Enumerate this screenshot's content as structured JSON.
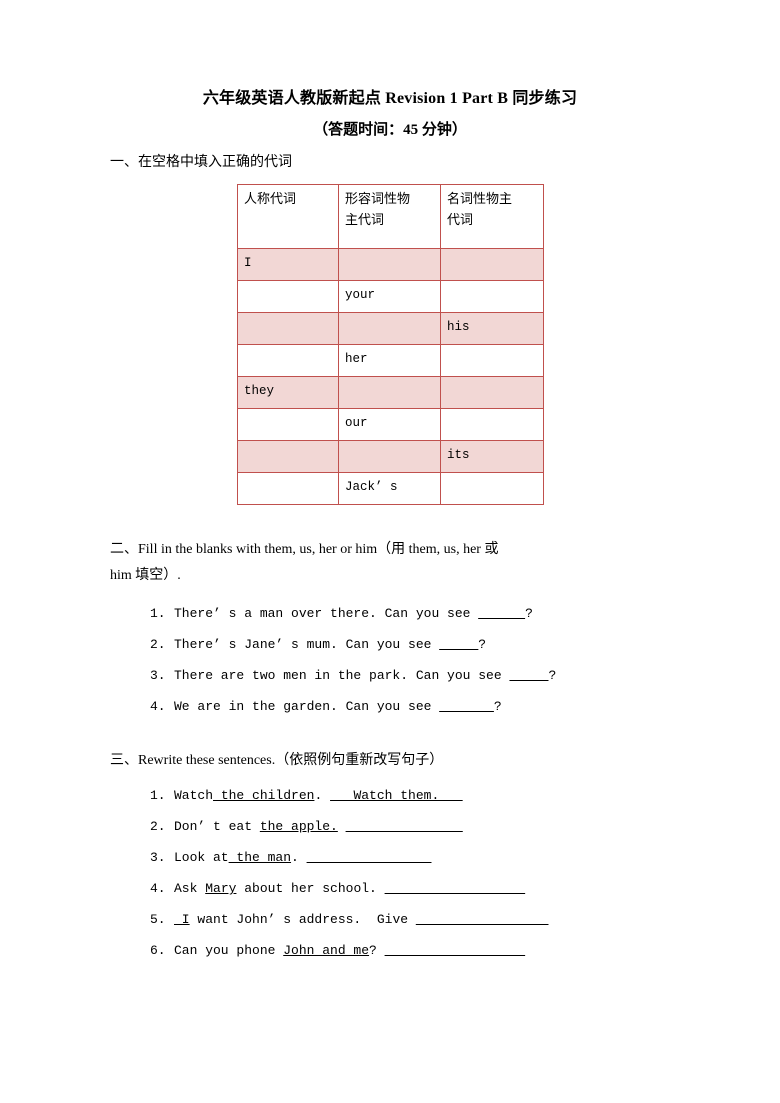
{
  "document": {
    "title": "六年级英语人教版新起点 Revision 1 Part B 同步练习",
    "subtitle": "（答题时间：45 分钟）"
  },
  "section_one": {
    "heading": "一、在空格中填入正确的代词",
    "table": {
      "headers": [
        "人称代词",
        "形容词性物主代词",
        "名词性物主代词"
      ],
      "header_cells": [
        {
          "line1": "人称代词",
          "line2": ""
        },
        {
          "line1": "形容词性物",
          "line2": "主代词"
        },
        {
          "line1": "名词性物主",
          "line2": "代词"
        }
      ],
      "rows": [
        {
          "shaded": true,
          "cells": [
            "I",
            "",
            ""
          ]
        },
        {
          "shaded": false,
          "cells": [
            "",
            "your",
            ""
          ]
        },
        {
          "shaded": true,
          "cells": [
            "",
            "",
            "his"
          ]
        },
        {
          "shaded": false,
          "cells": [
            "",
            "her",
            ""
          ]
        },
        {
          "shaded": true,
          "cells": [
            "they",
            "",
            ""
          ]
        },
        {
          "shaded": false,
          "cells": [
            "",
            "our",
            ""
          ]
        },
        {
          "shaded": true,
          "cells": [
            "",
            "",
            "its"
          ]
        },
        {
          "shaded": false,
          "cells": [
            "",
            "Jack’ s",
            ""
          ]
        }
      ]
    }
  },
  "section_two": {
    "heading_line1": "二、Fill in the blanks with them, us, her or him（用 them, us, her 或",
    "heading_line2": "him 填空）.",
    "items": [
      {
        "num": "1.",
        "pre": "There’ s a man over there. Can you see ",
        "blank": "______",
        "post": "?"
      },
      {
        "num": "2.",
        "pre": "There’ s Jane’ s mum. Can you see ",
        "blank": "_____",
        "post": "?"
      },
      {
        "num": "3.",
        "pre": "There are two men in the park. Can you see ",
        "blank": "_____",
        "post": "?"
      },
      {
        "num": "4.",
        "pre": "We are in the garden. Can you see ",
        "blank": "_______",
        "post": "?"
      }
    ]
  },
  "section_three": {
    "heading": "三、Rewrite these sentences.（依照例句重新改写句子）",
    "items": [
      {
        "num": "1.",
        "pre": "Watch",
        "underlined": " the children",
        "post": ". ",
        "answer": "   Watch them.   "
      },
      {
        "num": "2.",
        "pre": "Don’ t eat ",
        "underlined": "the apple.",
        "post": " ",
        "answer": "_______________"
      },
      {
        "num": "3.",
        "pre": "Look at",
        "underlined": " the man",
        "post": ". ",
        "answer": "________________"
      },
      {
        "num": "4.",
        "pre": "Ask ",
        "underlined": "Mary",
        "post": " about her school. ",
        "answer": "__________________"
      },
      {
        "num": "5.",
        "pre": "",
        "underlined": " I",
        "post": " want John’ s address.  Give ",
        "answer": "_________________"
      },
      {
        "num": "6.",
        "pre": "Can you phone ",
        "underlined": "John and me",
        "post": "? ",
        "answer": "__________________"
      }
    ]
  },
  "colors": {
    "table_border": "#c0504d",
    "table_shade": "#f2d7d5",
    "page_background": "#ffffff",
    "text": "#000000"
  }
}
